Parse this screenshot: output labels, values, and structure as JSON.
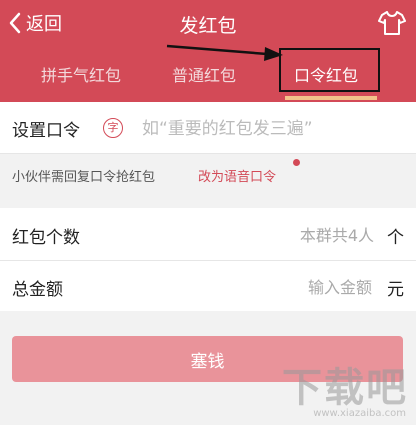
{
  "nav": {
    "back_label": "返回",
    "title": "发红包"
  },
  "tabs": [
    {
      "label": "拼手气红包",
      "active": false
    },
    {
      "label": "普通红包",
      "active": false
    },
    {
      "label": "口令红包",
      "active": true
    }
  ],
  "password": {
    "label": "设置口令",
    "icon_char": "字",
    "placeholder": "如“重要的红包发三遍”"
  },
  "hint": {
    "text": "小伙伴需回复口令抢红包",
    "link": "改为语音口令"
  },
  "count": {
    "label": "红包个数",
    "placeholder": "本群共4人",
    "unit": "个"
  },
  "amount": {
    "label": "总金额",
    "placeholder": "输入金额",
    "unit": "元"
  },
  "submit_label": "塞钱",
  "watermark": {
    "text": "下载吧",
    "url": "www.xiazaiba.com"
  },
  "colors": {
    "brand_red": "#d34a57",
    "button_disabled": "#e9939a",
    "tab_underline": "#f3c28a"
  },
  "icons": [
    "back-chevron-icon",
    "shirt-icon",
    "zi-icon",
    "arrow-annotation"
  ]
}
